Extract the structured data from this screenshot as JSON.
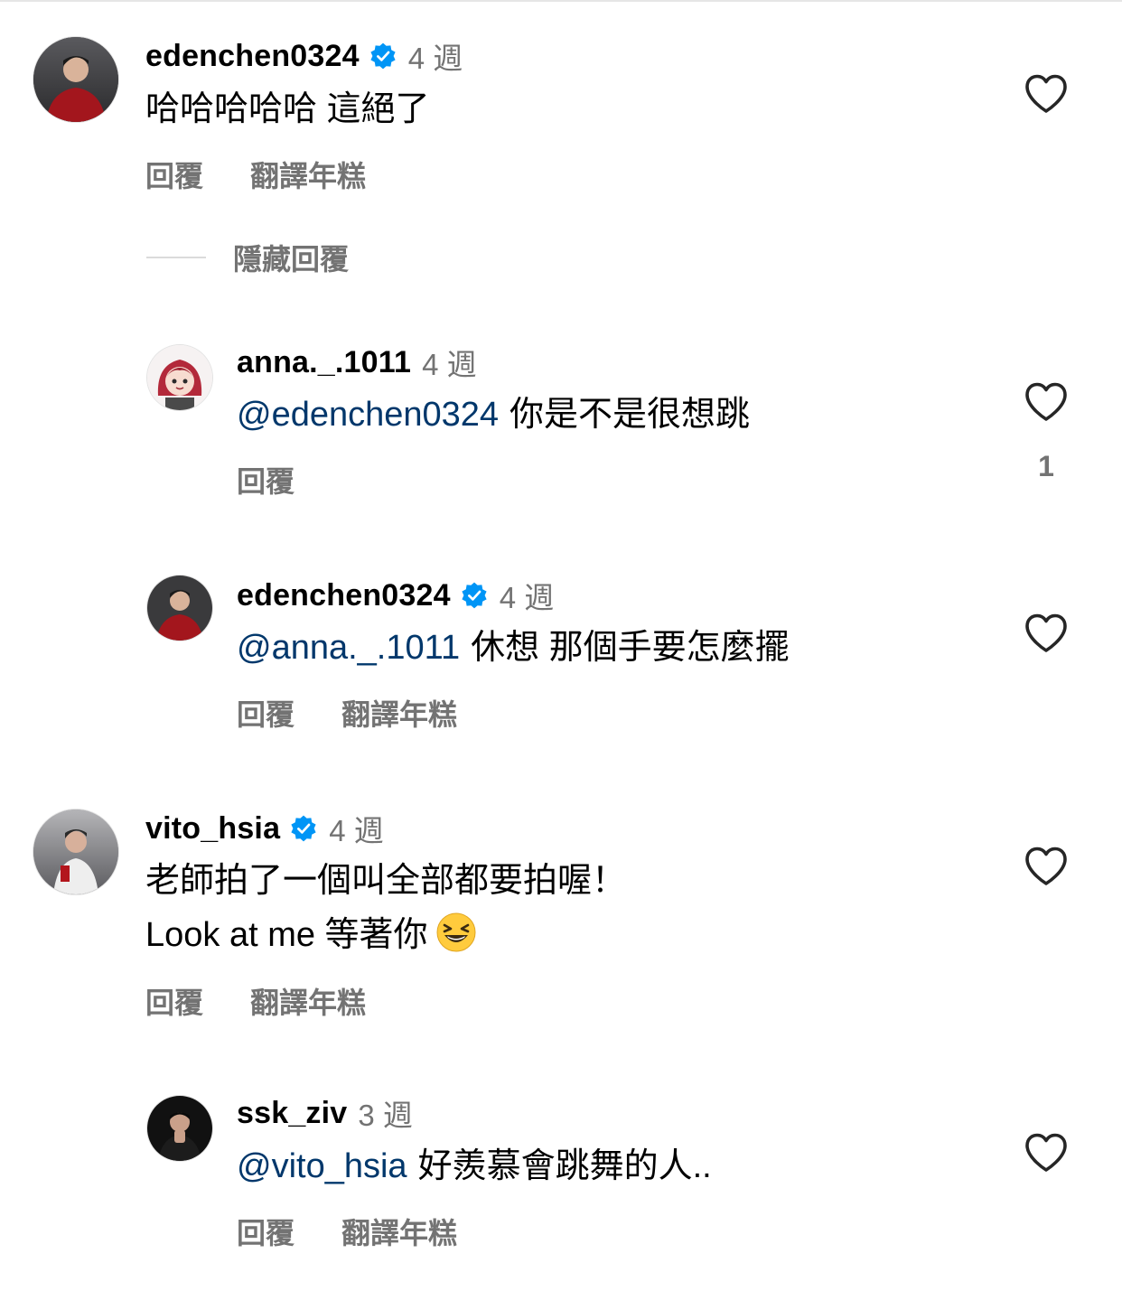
{
  "comments": [
    {
      "username": "edenchen0324",
      "verified": true,
      "time": "4 週",
      "mention": "",
      "text": "哈哈哈哈哈 這絕了",
      "reply_label": "回覆",
      "translate_label": "翻譯年糕",
      "likes": ""
    },
    {
      "username": "anna._.1011",
      "verified": false,
      "time": "4 週",
      "mention": "@edenchen0324",
      "text": "你是不是很想跳",
      "reply_label": "回覆",
      "translate_label": "",
      "likes": "1"
    },
    {
      "username": "edenchen0324",
      "verified": true,
      "time": "4 週",
      "mention": "@anna._.1011",
      "text": "休想 那個手要怎麼擺",
      "reply_label": "回覆",
      "translate_label": "翻譯年糕",
      "likes": ""
    },
    {
      "username": "vito_hsia",
      "verified": true,
      "time": "4 週",
      "mention": "",
      "text_line1": "老師拍了一個叫全部都要拍喔！",
      "text_line2": "Look at me 等著你",
      "emoji": "grinning-squinting-face-emoji",
      "reply_label": "回覆",
      "translate_label": "翻譯年糕",
      "likes": ""
    },
    {
      "username": "ssk_ziv",
      "verified": false,
      "time": "3 週",
      "mention": "@vito_hsia",
      "text": "好羨慕會跳舞的人..",
      "reply_label": "回覆",
      "translate_label": "翻譯年糕",
      "likes": ""
    }
  ],
  "hide_replies_label": "隱藏回覆",
  "icons": {
    "like": "heart-outline-icon",
    "verified": "verified-badge-icon"
  },
  "colors": {
    "mention": "#00376b",
    "secondary_text": "#737373",
    "verified_blue": "#0095f6"
  }
}
